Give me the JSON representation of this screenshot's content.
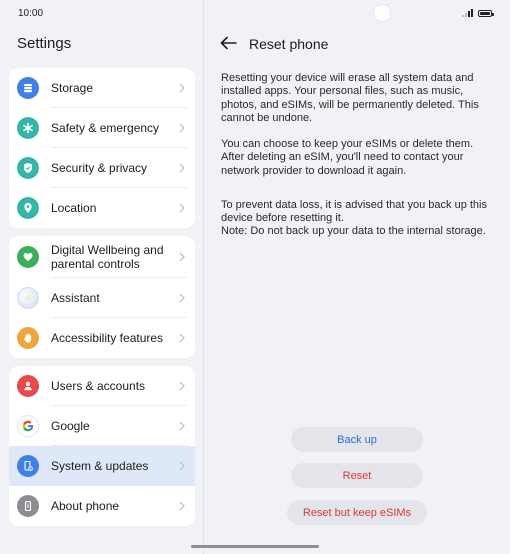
{
  "status_bar": {
    "time": "10:00"
  },
  "left_pane": {
    "title": "Settings",
    "groups": [
      [
        {
          "label": "Storage",
          "icon": "storage-icon",
          "color": "#3f7fe8"
        },
        {
          "label": "Safety & emergency",
          "icon": "asterisk-icon",
          "color": "#36b6a8"
        },
        {
          "label": "Security & privacy",
          "icon": "shield-icon",
          "color": "#36b6a8"
        },
        {
          "label": "Location",
          "icon": "location-pin-icon",
          "color": "#36b6a8"
        }
      ],
      [
        {
          "label": "Digital Wellbeing and parental controls",
          "icon": "heart-icon",
          "color": "#3fae5c"
        },
        {
          "label": "Assistant",
          "icon": "assistant-icon",
          "color": "#cfd8e8"
        },
        {
          "label": "Accessibility features",
          "icon": "hand-icon",
          "color": "#f0a43c"
        }
      ],
      [
        {
          "label": "Users & accounts",
          "icon": "person-icon",
          "color": "#e64a4a"
        },
        {
          "label": "Google",
          "icon": "google-icon",
          "color": "#ffffff"
        },
        {
          "label": "System & updates",
          "icon": "system-icon",
          "color": "#3f7fe8",
          "selected": true
        },
        {
          "label": "About phone",
          "icon": "phone-icon",
          "color": "#8b8d92"
        }
      ]
    ]
  },
  "right_pane": {
    "title": "Reset phone",
    "paragraphs": [
      "Resetting your device will erase all system data and installed apps. Your personal files, such as music, photos, and eSIMs, will be permanently deleted. This cannot be undone.",
      "You can choose to keep your eSIMs or delete them. After deleting an eSIM, you'll need to contact your network provider to download it again.",
      "To prevent data loss, it is advised that you back up this device before resetting it.",
      "Note: Do not back up your data to the internal storage."
    ],
    "buttons": {
      "backup": "Back up",
      "reset": "Reset",
      "reset_keep": "Reset but keep eSIMs"
    }
  },
  "colors": {
    "accent_blue": "#2f6fd6",
    "danger_red": "#d93b3b",
    "background": "#f0f2f6"
  }
}
